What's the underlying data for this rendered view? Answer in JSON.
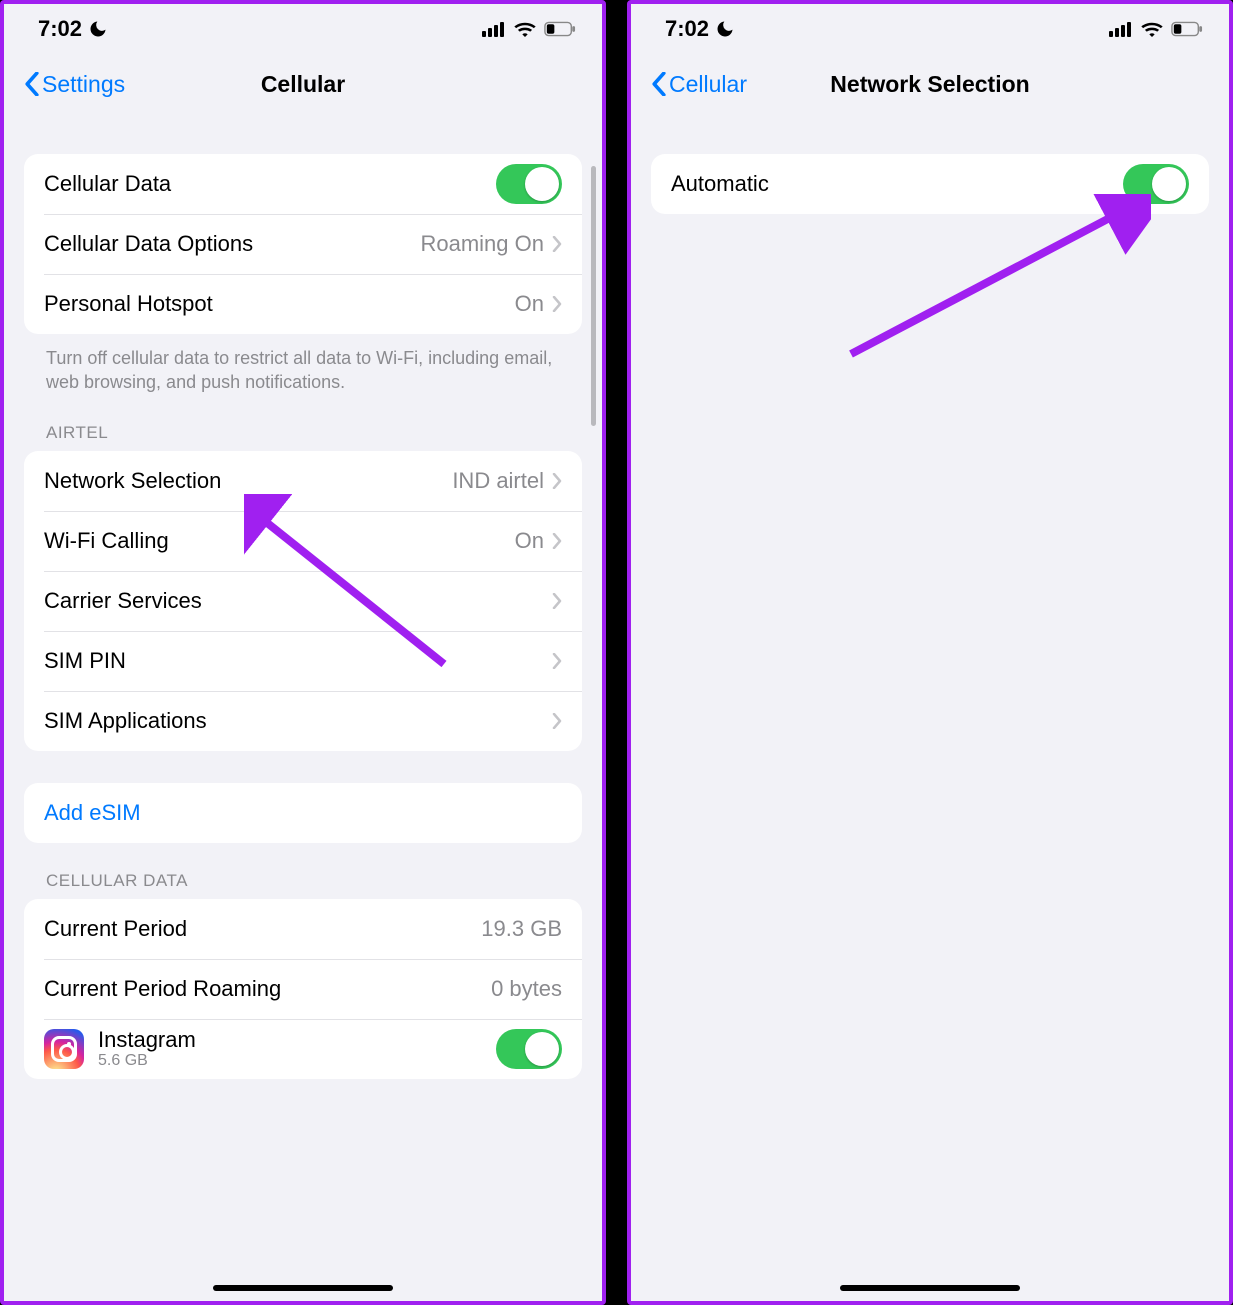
{
  "statusbar": {
    "time": "7:02"
  },
  "left": {
    "back_label": "Settings",
    "title": "Cellular",
    "group1": {
      "cellular_data": "Cellular Data",
      "data_options": "Cellular Data Options",
      "data_options_value": "Roaming On",
      "hotspot": "Personal Hotspot",
      "hotspot_value": "On"
    },
    "data_footer": "Turn off cellular data to restrict all data to Wi-Fi, including email, web browsing, and push notifications.",
    "carrier_header": "AIRTEL",
    "group2": {
      "network_selection": "Network Selection",
      "network_selection_value": "IND airtel",
      "wifi_calling": "Wi-Fi Calling",
      "wifi_calling_value": "On",
      "carrier_services": "Carrier Services",
      "sim_pin": "SIM PIN",
      "sim_apps": "SIM Applications"
    },
    "add_esim": "Add eSIM",
    "usage_header": "CELLULAR DATA",
    "usage": {
      "current_period": "Current Period",
      "current_period_value": "19.3 GB",
      "roaming": "Current Period Roaming",
      "roaming_value": "0 bytes",
      "app_name": "Instagram",
      "app_size": "5.6 GB"
    }
  },
  "right": {
    "back_label": "Cellular",
    "title": "Network Selection",
    "automatic": "Automatic"
  }
}
